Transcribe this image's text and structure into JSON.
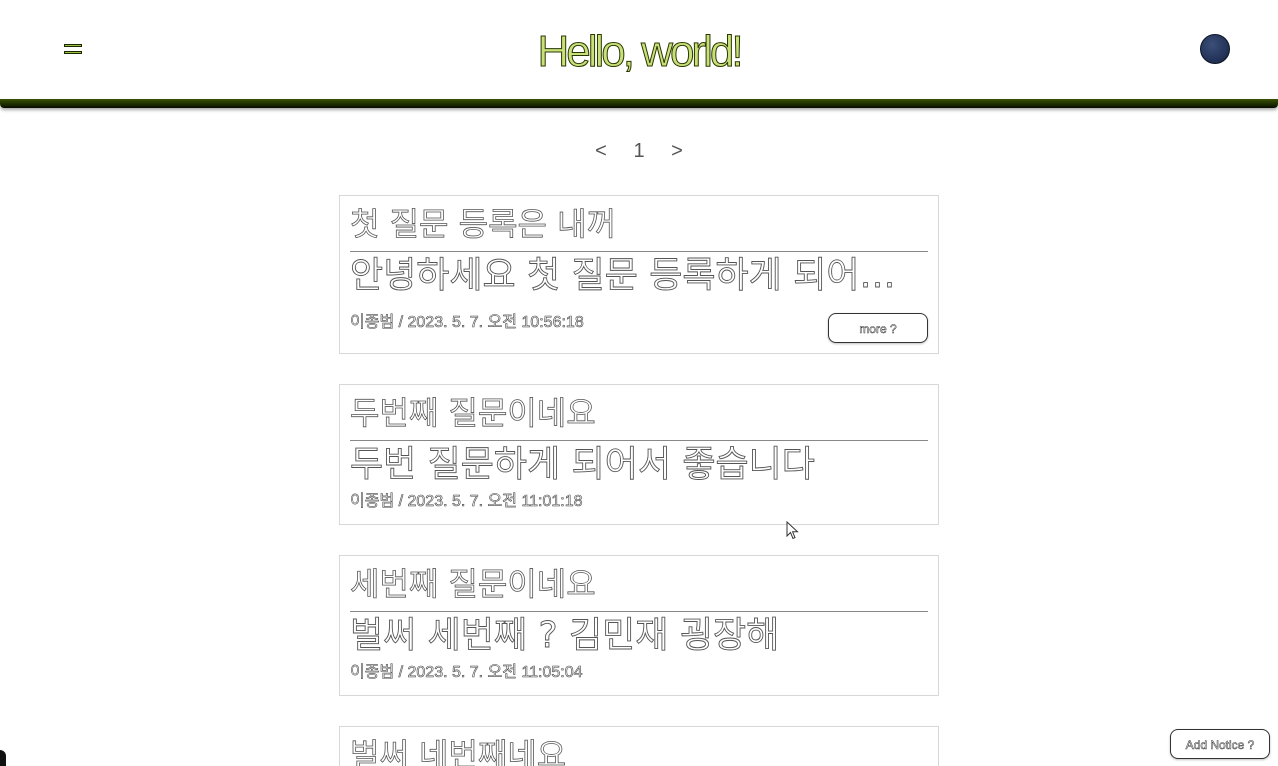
{
  "header": {
    "title": "Hello, world!",
    "menu_icon": "hamburger-menu-icon",
    "avatar_icon": "user-avatar",
    "accent_color": "#2b3a00",
    "title_color": "#c8e07a"
  },
  "pagination": {
    "prev": "<",
    "current": "1",
    "next": ">"
  },
  "notices": [
    {
      "title": "첫 질문 등록은 내꺼",
      "body": "안녕하세요 첫 질문 등록하게 되어서 기쁩니다",
      "meta": "이종범 / 2023. 5. 7. 오전 10:56:18",
      "more_label": "more ?"
    },
    {
      "title": "두번째 질문이네요",
      "body": "두번 질문하게 되어서 좋습니다",
      "meta": "이종범 / 2023. 5. 7. 오전 11:01:18"
    },
    {
      "title": "세번째 질문이네요",
      "body": "벌써 세번째 ? 김민재 굉장해",
      "meta": "이종범 / 2023. 5. 7. 오전 11:05:04"
    },
    {
      "title": "벌써 네번째네요"
    }
  ],
  "add_notice_label": "Add Notice ?"
}
